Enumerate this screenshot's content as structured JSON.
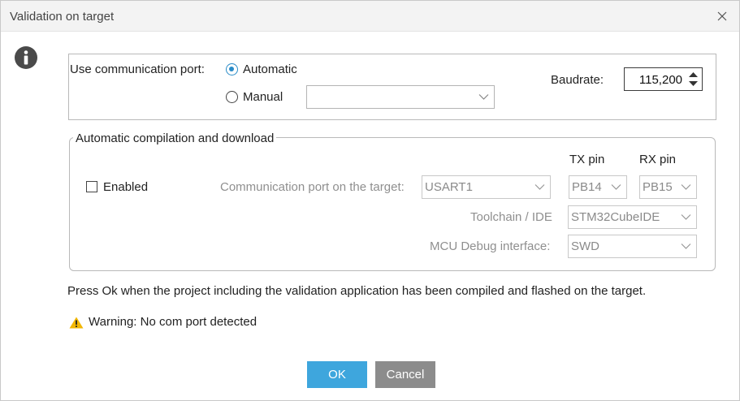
{
  "window": {
    "title": "Validation on target"
  },
  "icons": {
    "close": "close-icon",
    "info": "info-icon",
    "warning": "warning-icon",
    "chevron": "chevron-down-icon"
  },
  "port_section": {
    "label": "Use communication port:",
    "automatic_label": "Automatic",
    "automatic_selected": true,
    "manual_label": "Manual",
    "manual_selected": false,
    "manual_port_value": "",
    "baudrate_label": "Baudrate:",
    "baudrate_value": "115,200"
  },
  "compile_section": {
    "legend": "Automatic compilation and download",
    "enabled_label": "Enabled",
    "enabled_checked": false,
    "tx_pin_header": "TX pin",
    "rx_pin_header": "RX pin",
    "comm_port_label": "Communication port on the target:",
    "comm_port_value": "USART1",
    "tx_pin_value": "PB14",
    "rx_pin_value": "PB15",
    "toolchain_label": "Toolchain / IDE",
    "toolchain_value": "STM32CubeIDE",
    "debug_label": "MCU Debug interface:",
    "debug_value": "SWD"
  },
  "message": "Press Ok when the project including the validation application has been compiled and flashed on the target.",
  "warning": "Warning: No com port detected",
  "buttons": {
    "ok": "OK",
    "cancel": "Cancel"
  },
  "colors": {
    "accent": "#3ea6dd",
    "cancel": "#8c8c8c",
    "warning": "#f2b705",
    "radio": "#2a8cc8"
  }
}
